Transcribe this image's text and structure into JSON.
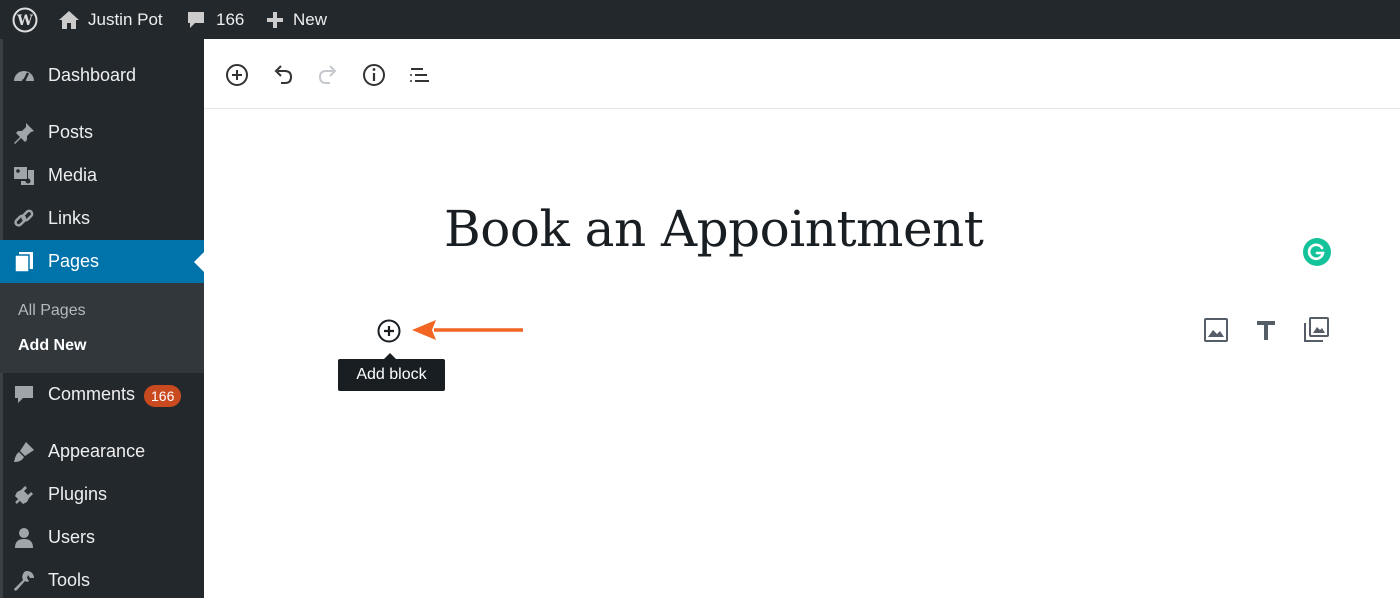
{
  "adminbar": {
    "site_name": "Justin Pot",
    "comments_count": "166",
    "new_label": "New"
  },
  "sidebar": {
    "items": [
      {
        "label": "Dashboard",
        "icon": "dashboard-icon"
      },
      {
        "label": "Posts",
        "icon": "pin-icon"
      },
      {
        "label": "Media",
        "icon": "media-icon"
      },
      {
        "label": "Links",
        "icon": "link-icon"
      },
      {
        "label": "Pages",
        "icon": "pages-icon",
        "active": true
      },
      {
        "label": "Comments",
        "icon": "comment-icon",
        "badge": "166"
      },
      {
        "label": "Appearance",
        "icon": "brush-icon"
      },
      {
        "label": "Plugins",
        "icon": "plugin-icon"
      },
      {
        "label": "Users",
        "icon": "user-icon"
      },
      {
        "label": "Tools",
        "icon": "wrench-icon"
      }
    ],
    "submenu": [
      {
        "label": "All Pages"
      },
      {
        "label": "Add New",
        "current": true
      }
    ]
  },
  "editor": {
    "title": "Book an Appointment",
    "tooltip": "Add block"
  },
  "colors": {
    "admin_dark": "#23282d",
    "active_blue": "#0073aa",
    "badge_orange": "#ca4a1f",
    "arrow_orange": "#f26522",
    "grammarly_green": "#15c39a"
  }
}
